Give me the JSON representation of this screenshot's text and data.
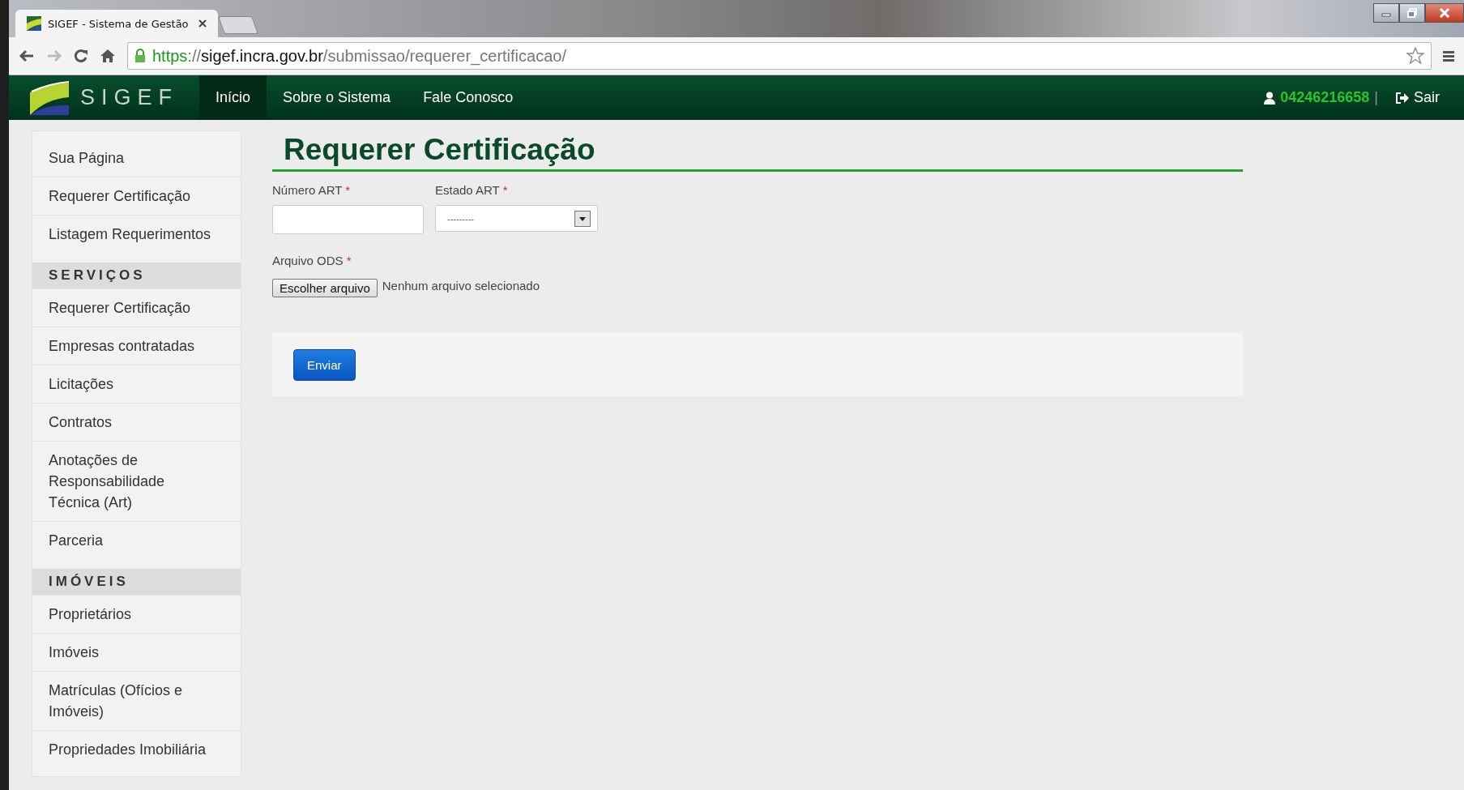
{
  "browser": {
    "tab_title": "SIGEF - Sistema de Gestão",
    "url_scheme": "https",
    "url_separator": "://",
    "url_host": "sigef.incra.gov.br",
    "url_path": "/submissao/requerer_certificacao/"
  },
  "navbar": {
    "brand": "SIGEF",
    "items": [
      {
        "label": "Início",
        "selected": true
      },
      {
        "label": "Sobre o Sistema",
        "selected": false
      },
      {
        "label": "Fale Conosco",
        "selected": false
      }
    ],
    "user": "04246216658",
    "separator": "|",
    "logout": "Sair"
  },
  "sidebar": {
    "items": [
      {
        "kind": "link",
        "label": "Sua Página"
      },
      {
        "kind": "link",
        "label": "Requerer Certificação"
      },
      {
        "kind": "link",
        "label": "Listagem Requerimentos"
      },
      {
        "kind": "heading",
        "label": "SERVIÇOS"
      },
      {
        "kind": "link",
        "label": "Requerer Certificação"
      },
      {
        "kind": "link",
        "label": "Empresas contratadas"
      },
      {
        "kind": "link",
        "label": "Licitações"
      },
      {
        "kind": "link",
        "label": "Contratos"
      },
      {
        "kind": "link",
        "label": "Anotações de Responsabilidade Técnica (Art)"
      },
      {
        "kind": "link",
        "label": "Parceria"
      },
      {
        "kind": "heading",
        "label": "IMÓVEIS"
      },
      {
        "kind": "link",
        "label": "Proprietários"
      },
      {
        "kind": "link",
        "label": "Imóveis"
      },
      {
        "kind": "link",
        "label": "Matrículas (Ofícios e Imóveis)"
      },
      {
        "kind": "link",
        "label": "Propriedades Imobiliária"
      }
    ]
  },
  "form": {
    "title": "Requerer Certificação",
    "fields": [
      {
        "kind": "text",
        "label": "Número ART",
        "required_mark": "*"
      },
      {
        "kind": "select",
        "label": "Estado ART",
        "required_mark": "*",
        "value": "---------"
      },
      {
        "kind": "file",
        "label": "Arquivo ODS",
        "required_mark": "*",
        "button": "Escolher arquivo",
        "status": "Nenhum arquivo selecionado"
      }
    ],
    "submit": "Enviar"
  }
}
